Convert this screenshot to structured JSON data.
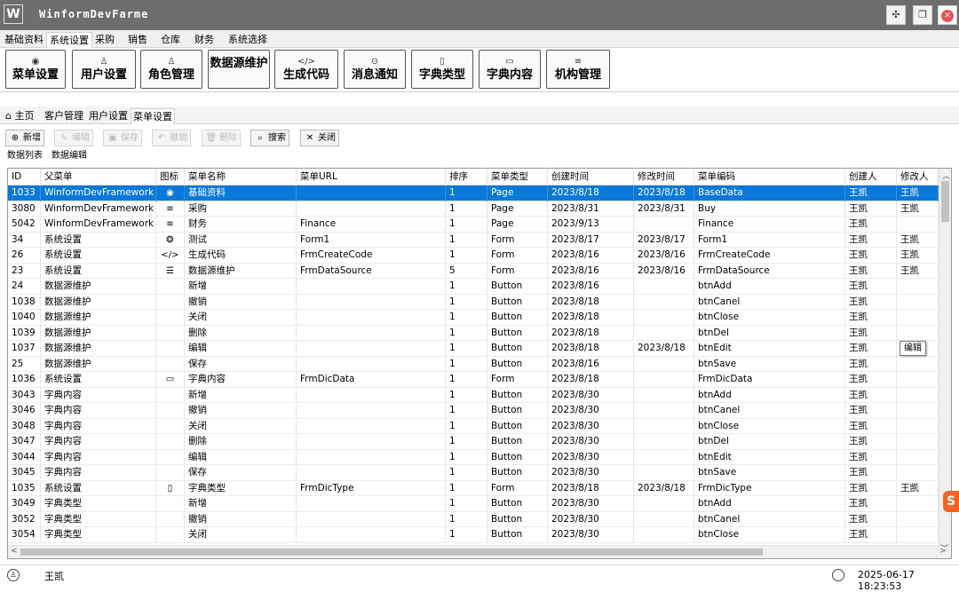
{
  "window": {
    "logo": "W",
    "title": "WinformDevFarme",
    "pin_icon": "pin-icon",
    "restore_icon": "restore-icon",
    "close_icon": "close-icon"
  },
  "menu_tabs": [
    "基础资料",
    "系统设置",
    "采购",
    "销售",
    "仓库",
    "财务",
    "系统选择"
  ],
  "ribbon_buttons": [
    {
      "label": "菜单设置",
      "icon": "◉"
    },
    {
      "label": "用户设置",
      "icon": "♙"
    },
    {
      "label": "角色管理",
      "icon": "♙"
    },
    {
      "label": "数据源维护",
      "icon": "☰"
    },
    {
      "label": "生成代码",
      "icon": "</>"
    },
    {
      "label": "消息通知",
      "icon": "⊙"
    },
    {
      "label": "字典类型",
      "icon": "▯"
    },
    {
      "label": "字典内容",
      "icon": "▭"
    },
    {
      "label": "机构管理",
      "icon": "≡"
    }
  ],
  "doc_tabs": [
    "主页",
    "客户管理",
    "用户设置",
    "菜单设置"
  ],
  "toolbar": [
    {
      "label": "新增",
      "icon": "⊕",
      "enabled": true
    },
    {
      "label": "编辑",
      "icon": "✎",
      "enabled": false
    },
    {
      "label": "保存",
      "icon": "▣",
      "enabled": false
    },
    {
      "label": "撤销",
      "icon": "↶",
      "enabled": false
    },
    {
      "label": "删除",
      "icon": "🗑",
      "enabled": false
    },
    {
      "label": "搜索",
      "icon": "⌕",
      "enabled": true
    },
    {
      "label": "关闭",
      "icon": "✕",
      "enabled": true
    }
  ],
  "sub_tabs": [
    "数据列表",
    "数据编辑"
  ],
  "grid": {
    "columns": [
      "ID",
      "父菜单",
      "图标",
      "菜单名称",
      "菜单URL",
      "排序",
      "菜单类型",
      "创建时间",
      "修改时间",
      "菜单编码",
      "创建人",
      "修改人"
    ],
    "selected_row": 0,
    "rows": [
      [
        "1033",
        "WinformDevFramework",
        "◉",
        "基础资料",
        "",
        "1",
        "Page",
        "2023/8/18",
        "2023/8/18",
        "BaseData",
        "王凯",
        "王凯"
      ],
      [
        "3080",
        "WinformDevFramework",
        "≡",
        "采购",
        "",
        "1",
        "Page",
        "2023/8/31",
        "2023/8/31",
        "Buy",
        "王凯",
        "王凯"
      ],
      [
        "5042",
        "WinformDevFramework",
        "≡",
        "财务",
        "Finance",
        "1",
        "Page",
        "2023/9/13",
        "",
        "Finance",
        "王凯",
        ""
      ],
      [
        "34",
        "系统设置",
        "❂",
        "测试",
        "Form1",
        "1",
        "Form",
        "2023/8/17",
        "2023/8/17",
        "Form1",
        "王凯",
        "王凯"
      ],
      [
        "26",
        "系统设置",
        "</>",
        "生成代码",
        "FrmCreateCode",
        "1",
        "Form",
        "2023/8/16",
        "2023/8/16",
        "FrmCreateCode",
        "王凯",
        "王凯"
      ],
      [
        "23",
        "系统设置",
        "☰",
        "数据源维护",
        "FrmDataSource",
        "5",
        "Form",
        "2023/8/16",
        "2023/8/16",
        "FrmDataSource",
        "王凯",
        "王凯"
      ],
      [
        "24",
        "数据源维护",
        "",
        "新增",
        "",
        "1",
        "Button",
        "2023/8/16",
        "",
        "btnAdd",
        "王凯",
        ""
      ],
      [
        "1038",
        "数据源维护",
        "",
        "撤销",
        "",
        "1",
        "Button",
        "2023/8/18",
        "",
        "btnCanel",
        "王凯",
        ""
      ],
      [
        "1040",
        "数据源维护",
        "",
        "关闭",
        "",
        "1",
        "Button",
        "2023/8/18",
        "",
        "btnClose",
        "王凯",
        ""
      ],
      [
        "1039",
        "数据源维护",
        "",
        "删除",
        "",
        "1",
        "Button",
        "2023/8/18",
        "",
        "btnDel",
        "王凯",
        ""
      ],
      [
        "1037",
        "数据源维护",
        "",
        "编辑",
        "",
        "1",
        "Button",
        "2023/8/18",
        "2023/8/18",
        "btnEdit",
        "王凯",
        ""
      ],
      [
        "25",
        "数据源维护",
        "",
        "保存",
        "",
        "1",
        "Button",
        "2023/8/16",
        "",
        "btnSave",
        "王凯",
        ""
      ],
      [
        "1036",
        "系统设置",
        "▭",
        "字典内容",
        "FrmDicData",
        "1",
        "Form",
        "2023/8/18",
        "",
        "FrmDicData",
        "王凯",
        ""
      ],
      [
        "3043",
        "字典内容",
        "",
        "新增",
        "",
        "1",
        "Button",
        "2023/8/30",
        "",
        "btnAdd",
        "王凯",
        ""
      ],
      [
        "3046",
        "字典内容",
        "",
        "撤销",
        "",
        "1",
        "Button",
        "2023/8/30",
        "",
        "btnCanel",
        "王凯",
        ""
      ],
      [
        "3048",
        "字典内容",
        "",
        "关闭",
        "",
        "1",
        "Button",
        "2023/8/30",
        "",
        "btnClose",
        "王凯",
        ""
      ],
      [
        "3047",
        "字典内容",
        "",
        "删除",
        "",
        "1",
        "Button",
        "2023/8/30",
        "",
        "btnDel",
        "王凯",
        ""
      ],
      [
        "3044",
        "字典内容",
        "",
        "编辑",
        "",
        "1",
        "Button",
        "2023/8/30",
        "",
        "btnEdit",
        "王凯",
        ""
      ],
      [
        "3045",
        "字典内容",
        "",
        "保存",
        "",
        "1",
        "Button",
        "2023/8/30",
        "",
        "btnSave",
        "王凯",
        ""
      ],
      [
        "1035",
        "系统设置",
        "▯",
        "字典类型",
        "FrmDicType",
        "1",
        "Form",
        "2023/8/18",
        "2023/8/18",
        "FrmDicType",
        "王凯",
        "王凯"
      ],
      [
        "3049",
        "字典类型",
        "",
        "新增",
        "",
        "1",
        "Button",
        "2023/8/30",
        "",
        "btnAdd",
        "王凯",
        ""
      ],
      [
        "3052",
        "字典类型",
        "",
        "撤销",
        "",
        "1",
        "Button",
        "2023/8/30",
        "",
        "btnCanel",
        "王凯",
        ""
      ],
      [
        "3054",
        "字典类型",
        "",
        "关闭",
        "",
        "1",
        "Button",
        "2023/8/30",
        "",
        "btnClose",
        "王凯",
        ""
      ]
    ]
  },
  "tooltip": "编辑",
  "status": {
    "user": "王凯",
    "datetime": "2025-06-17 18:23:53"
  },
  "side_mark": "S",
  "colors": {
    "title_bar": "#6d6d6d",
    "selection": "#0a79d9"
  }
}
